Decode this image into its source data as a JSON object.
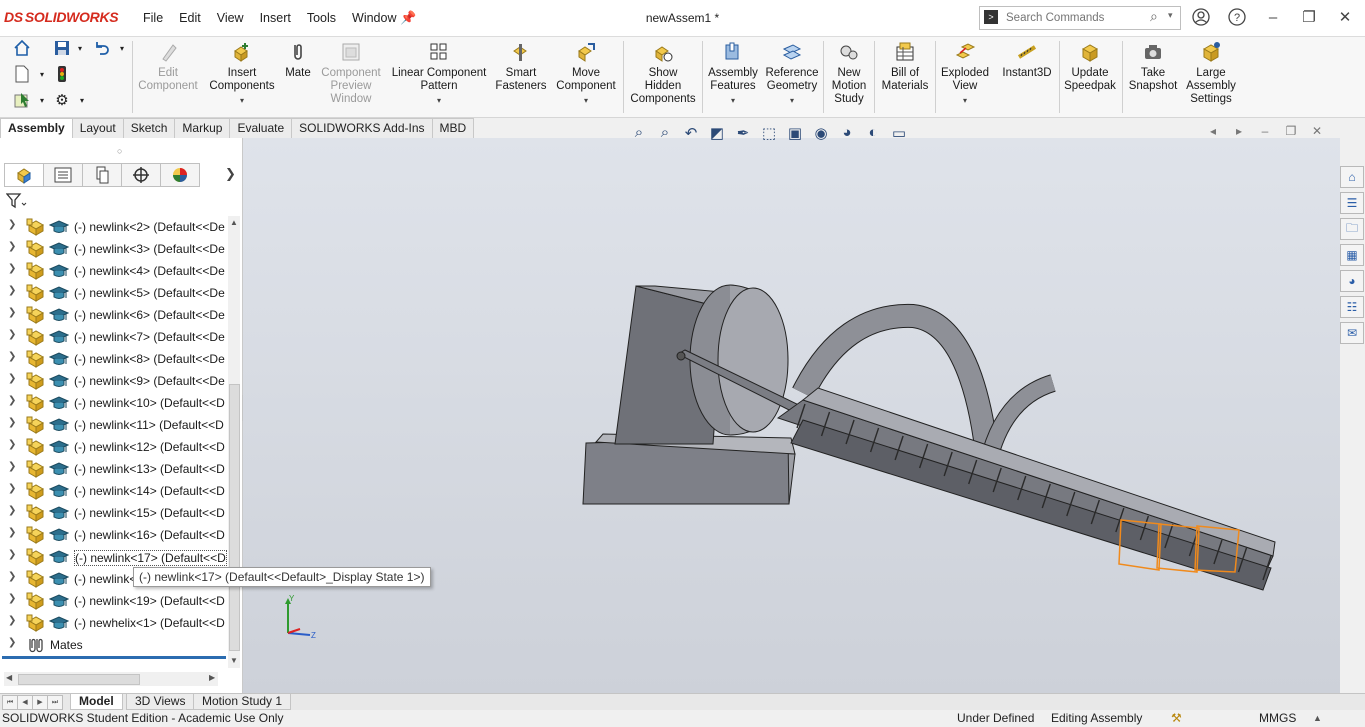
{
  "app": {
    "logo_ds": "DS",
    "logo_text": "SOLIDWORKS",
    "document_title": "newAssem1 *"
  },
  "menu": [
    "File",
    "Edit",
    "View",
    "Insert",
    "Tools",
    "Window"
  ],
  "search": {
    "placeholder": "Search Commands"
  },
  "toolbar": {
    "edit_component": [
      "Edit",
      "Component"
    ],
    "insert_components": [
      "Insert",
      "Components"
    ],
    "mate": [
      "Mate"
    ],
    "component_preview": [
      "Component",
      "Preview",
      "Window"
    ],
    "linear_pattern": [
      "Linear Component",
      "Pattern"
    ],
    "smart_fasteners": [
      "Smart",
      "Fasteners"
    ],
    "move_component": [
      "Move",
      "Component"
    ],
    "show_hidden": [
      "Show",
      "Hidden",
      "Components"
    ],
    "assembly_features": [
      "Assembly",
      "Features"
    ],
    "reference_geometry": [
      "Reference",
      "Geometry"
    ],
    "new_motion_study": [
      "New",
      "Motion",
      "Study"
    ],
    "bill_of_materials": [
      "Bill of",
      "Materials"
    ],
    "exploded_view": [
      "Exploded",
      "View"
    ],
    "instant3d": [
      "Instant3D"
    ],
    "update_speedpak": [
      "Update",
      "Speedpak"
    ],
    "take_snapshot": [
      "Take",
      "Snapshot"
    ],
    "large_assembly": [
      "Large",
      "Assembly",
      "Settings"
    ]
  },
  "tabs": [
    "Assembly",
    "Layout",
    "Sketch",
    "Markup",
    "Evaluate",
    "SOLIDWORKS Add-Ins",
    "MBD"
  ],
  "tree": {
    "items": [
      "(-) newlink<2> (Default<<De",
      "(-) newlink<3> (Default<<De",
      "(-) newlink<4> (Default<<De",
      "(-) newlink<5> (Default<<De",
      "(-) newlink<6> (Default<<De",
      "(-) newlink<7> (Default<<De",
      "(-) newlink<8> (Default<<De",
      "(-) newlink<9> (Default<<De",
      "(-) newlink<10> (Default<<D",
      "(-) newlink<11> (Default<<D",
      "(-) newlink<12> (Default<<D",
      "(-) newlink<13> (Default<<D",
      "(-) newlink<14> (Default<<D",
      "(-) newlink<15> (Default<<D",
      "(-) newlink<16> (Default<<D",
      "(-) newlink<17> (Default<<D",
      "(-) newlink<18> (Default<<D",
      "(-) newlink<19> (Default<<D",
      "(-) newhelix<1> (Default<<D"
    ],
    "selected_index": 15,
    "mates_label": "Mates",
    "tooltip": "(-) newlink<17> (Default<<Default>_Display State 1>)"
  },
  "bottom_tabs": [
    "Model",
    "3D Views",
    "Motion Study 1"
  ],
  "status": {
    "edition": "SOLIDWORKS Student Edition - Academic Use Only",
    "definition": "Under Defined",
    "mode": "Editing Assembly",
    "units": "MMGS"
  },
  "colors": {
    "selection_orange": "#f08a1c",
    "model_gray": "#8a8c93",
    "viewport_top": "#dfe3ea"
  }
}
